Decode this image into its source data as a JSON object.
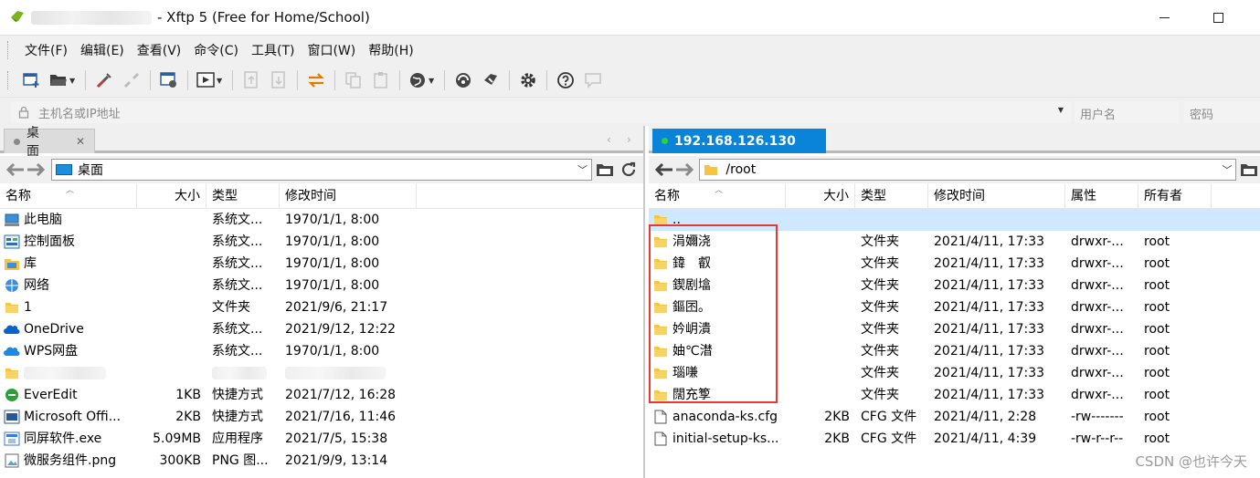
{
  "window": {
    "title": "- Xftp 5 (Free for Home/School)",
    "minimize_icon": "minimize-icon",
    "maximize_icon": "maximize-icon"
  },
  "menu": [
    "文件(F)",
    "编辑(E)",
    "查看(V)",
    "命令(C)",
    "工具(T)",
    "窗口(W)",
    "帮助(H)"
  ],
  "address": {
    "host_placeholder": "主机名或IP地址",
    "user_placeholder": "用户名",
    "password_placeholder": "密码"
  },
  "left_pane": {
    "tab_label": "桌面",
    "path": "桌面",
    "columns": [
      "名称",
      "大小",
      "类型",
      "修改时间"
    ],
    "rows": [
      {
        "name": "此电脑",
        "size": "",
        "type": "系统文...",
        "modified": "1970/1/1, 8:00",
        "icon": "computer-icon"
      },
      {
        "name": "控制面板",
        "size": "",
        "type": "系统文...",
        "modified": "1970/1/1, 8:00",
        "icon": "control-panel-icon"
      },
      {
        "name": "库",
        "size": "",
        "type": "系统文...",
        "modified": "1970/1/1, 8:00",
        "icon": "library-icon"
      },
      {
        "name": "网络",
        "size": "",
        "type": "系统文...",
        "modified": "1970/1/1, 8:00",
        "icon": "network-icon"
      },
      {
        "name": "1",
        "size": "",
        "type": "文件夹",
        "modified": "2021/9/6, 21:17",
        "icon": "folder-icon"
      },
      {
        "name": "OneDrive",
        "size": "",
        "type": "系统文...",
        "modified": "2021/9/12, 12:22",
        "icon": "onedrive-icon"
      },
      {
        "name": "WPS网盘",
        "size": "",
        "type": "系统文...",
        "modified": "1970/1/1, 8:00",
        "icon": "wps-cloud-icon"
      },
      {
        "name": "",
        "size": "",
        "type": "",
        "modified": "",
        "icon": "folder-icon",
        "blurred": true
      },
      {
        "name": "EverEdit",
        "size": "1KB",
        "type": "快捷方式",
        "modified": "2021/7/12, 16:28",
        "icon": "everedit-icon"
      },
      {
        "name": "Microsoft Offi...",
        "size": "2KB",
        "type": "快捷方式",
        "modified": "2021/7/16, 11:46",
        "icon": "office-icon"
      },
      {
        "name": "同屏软件.exe",
        "size": "5.09MB",
        "type": "应用程序",
        "modified": "2021/7/5, 15:38",
        "icon": "app-icon"
      },
      {
        "name": "微服务组件.png",
        "size": "300KB",
        "type": "PNG 图...",
        "modified": "2021/9/9, 13:14",
        "icon": "image-file-icon"
      }
    ]
  },
  "right_pane": {
    "tab_label": "192.168.126.130",
    "path": "/root",
    "columns": [
      "名称",
      "大小",
      "类型",
      "修改时间",
      "属性",
      "所有者"
    ],
    "rows": [
      {
        "name": "..",
        "size": "",
        "type": "",
        "modified": "",
        "attrs": "",
        "owner": "",
        "icon": "folder-icon",
        "selected": true
      },
      {
        "name": "涓嬭浇",
        "size": "",
        "type": "文件夹",
        "modified": "2021/4/11, 17:33",
        "attrs": "drwxr-...",
        "owner": "root",
        "icon": "folder-icon"
      },
      {
        "name": "鍏　叡",
        "size": "",
        "type": "文件夹",
        "modified": "2021/4/11, 17:33",
        "attrs": "drwxr-...",
        "owner": "root",
        "icon": "folder-icon"
      },
      {
        "name": "鍥剧墖",
        "size": "",
        "type": "文件夹",
        "modified": "2021/4/11, 17:33",
        "attrs": "drwxr-...",
        "owner": "root",
        "icon": "folder-icon"
      },
      {
        "name": "鏂囨。",
        "size": "",
        "type": "文件夹",
        "modified": "2021/4/11, 17:33",
        "attrs": "drwxr-...",
        "owner": "root",
        "icon": "folder-icon"
      },
      {
        "name": "妗岄潰",
        "size": "",
        "type": "文件夹",
        "modified": "2021/4/11, 17:33",
        "attrs": "drwxr-...",
        "owner": "root",
        "icon": "folder-icon"
      },
      {
        "name": "妯℃澘",
        "size": "",
        "type": "文件夹",
        "modified": "2021/4/11, 17:33",
        "attrs": "drwxr-...",
        "owner": "root",
        "icon": "folder-icon"
      },
      {
        "name": "瑙嗛",
        "size": "",
        "type": "文件夹",
        "modified": "2021/4/11, 17:33",
        "attrs": "drwxr-...",
        "owner": "root",
        "icon": "folder-icon"
      },
      {
        "name": "闊充箰",
        "size": "",
        "type": "文件夹",
        "modified": "2021/4/11, 17:33",
        "attrs": "drwxr-...",
        "owner": "root",
        "icon": "folder-icon"
      },
      {
        "name": "anaconda-ks.cfg",
        "size": "2KB",
        "type": "CFG 文件",
        "modified": "2021/4/11, 2:28",
        "attrs": "-rw-------",
        "owner": "root",
        "icon": "file-icon"
      },
      {
        "name": "initial-setup-ks...",
        "size": "2KB",
        "type": "CFG 文件",
        "modified": "2021/4/11, 4:39",
        "attrs": "-rw-r--r--",
        "owner": "root",
        "icon": "file-icon"
      }
    ]
  },
  "watermark": "CSDN @也许今天",
  "colors": {
    "accent": "#0a84d8",
    "highlight_box": "#e53935",
    "folder": "#f5c542"
  }
}
